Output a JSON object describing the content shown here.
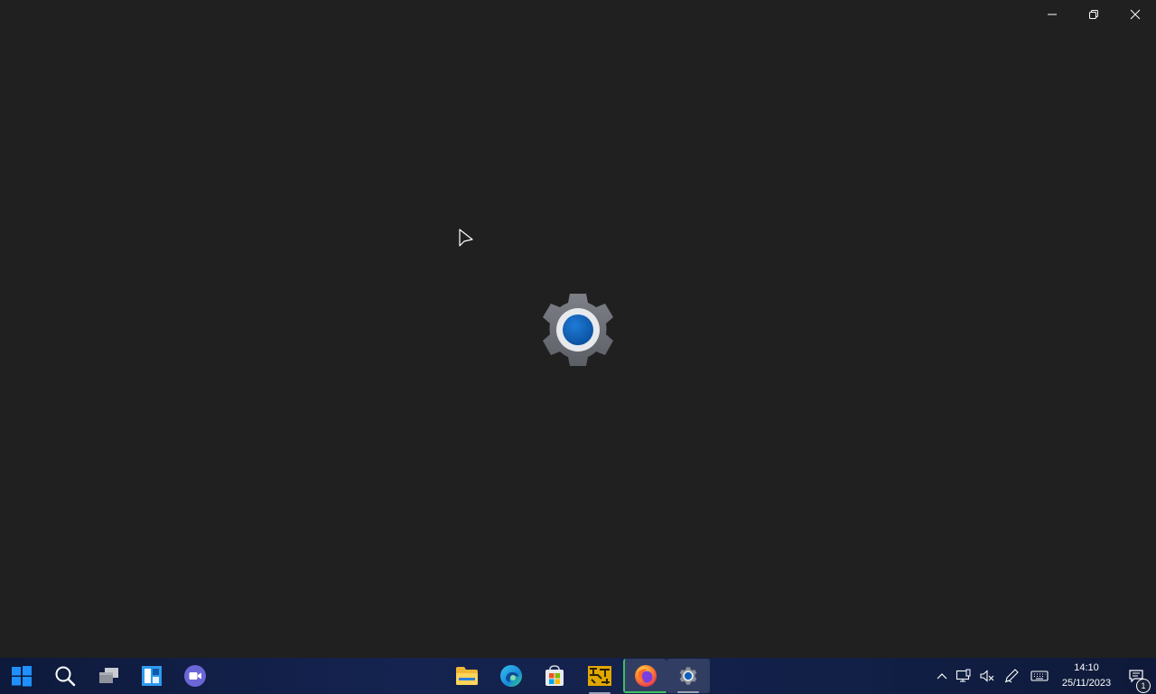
{
  "window": {
    "controls": [
      "minimize",
      "restore",
      "close"
    ]
  },
  "splash": {
    "icon": "settings-gear-icon"
  },
  "taskbar": {
    "pinned_left": [
      {
        "name": "start-button",
        "icon": "windows-logo-icon"
      },
      {
        "name": "search-button",
        "icon": "search-icon"
      },
      {
        "name": "task-view-button",
        "icon": "task-view-icon"
      },
      {
        "name": "widgets-button",
        "icon": "widgets-icon"
      },
      {
        "name": "teams-chat-button",
        "icon": "teams-chat-icon"
      }
    ],
    "apps": [
      {
        "name": "file-explorer",
        "icon": "folder-icon"
      },
      {
        "name": "edge",
        "icon": "edge-icon"
      },
      {
        "name": "microsoft-store",
        "icon": "store-icon"
      },
      {
        "name": "app-yellow",
        "icon": "grid-app-icon"
      },
      {
        "name": "firefox",
        "icon": "firefox-icon"
      },
      {
        "name": "settings",
        "icon": "gear-icon"
      }
    ],
    "tray": {
      "icons": [
        "chevron-up-icon",
        "network-icon",
        "volume-muted-icon",
        "pen-icon",
        "keyboard-icon"
      ],
      "time": "14:10",
      "date": "25/11/2023",
      "notification_count": "1"
    }
  },
  "colors": {
    "background": "#202020",
    "accent": "#0f5fb8"
  }
}
